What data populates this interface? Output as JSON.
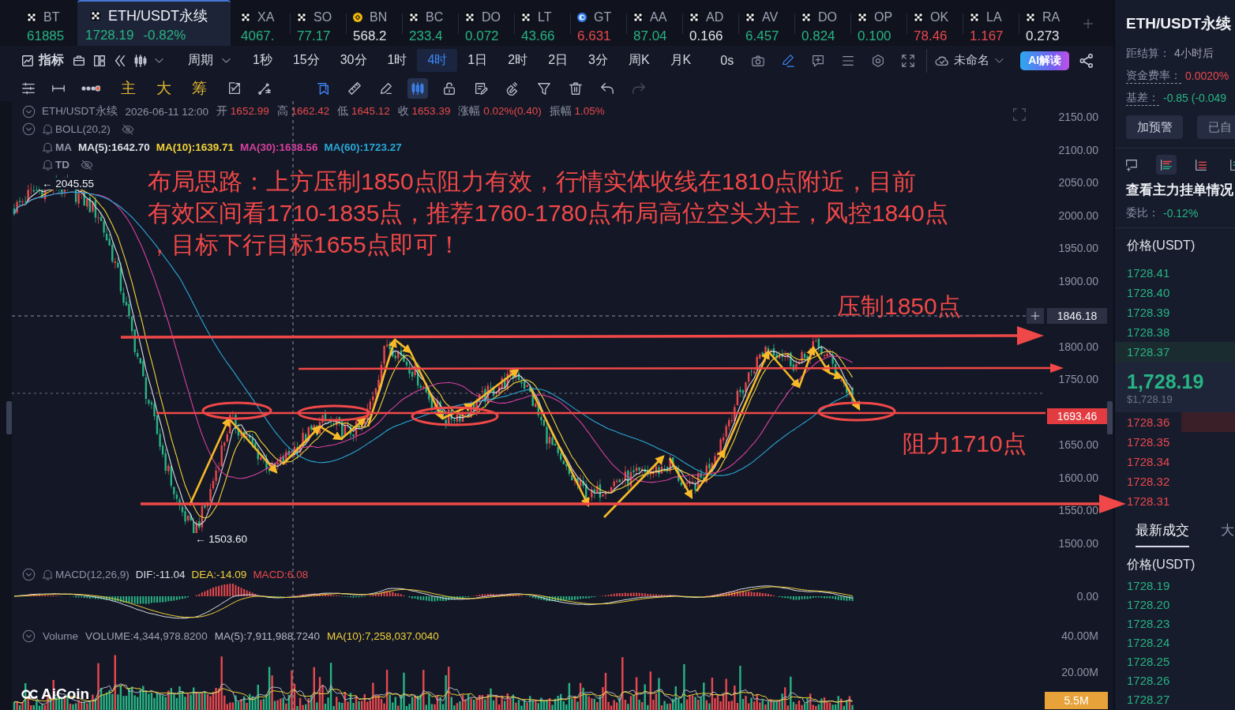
{
  "tabs": [
    {
      "kind": "x",
      "symbol": "BT",
      "price": "61885",
      "color": "#27b383",
      "selected": false
    },
    {
      "kind": "x",
      "symbol": "ETH/USDT永续",
      "price": "1728.19",
      "change": "-0.82%",
      "color": "#27b383",
      "selected": true
    },
    {
      "kind": "x",
      "symbol": "XA",
      "price": "4067.",
      "color": "#27b383",
      "selected": false
    },
    {
      "kind": "x",
      "symbol": "SO",
      "price": "77.17",
      "color": "#27b383",
      "selected": false
    },
    {
      "kind": "coin",
      "symbol": "BN",
      "price": "568.2",
      "color": "#dfe2ea",
      "selected": false
    },
    {
      "kind": "x",
      "symbol": "BC",
      "price": "233.4",
      "color": "#27b383",
      "selected": false
    },
    {
      "kind": "x",
      "symbol": "DO",
      "price": "0.072",
      "color": "#27b383",
      "selected": false
    },
    {
      "kind": "x",
      "symbol": "LT",
      "price": "43.66",
      "color": "#27b383",
      "selected": false
    },
    {
      "kind": "ring",
      "symbol": "GT",
      "price": "6.631",
      "color": "#e8484d",
      "selected": false
    },
    {
      "kind": "x",
      "symbol": "AA",
      "price": "87.04",
      "color": "#27b383",
      "selected": false
    },
    {
      "kind": "x",
      "symbol": "AD",
      "price": "0.166",
      "color": "#dfe2ea",
      "selected": false
    },
    {
      "kind": "x",
      "symbol": "AV",
      "price": "6.457",
      "color": "#27b383",
      "selected": false
    },
    {
      "kind": "x",
      "symbol": "DO",
      "price": "0.824",
      "color": "#27b383",
      "selected": false
    },
    {
      "kind": "x",
      "symbol": "OP",
      "price": "0.100",
      "color": "#27b383",
      "selected": false
    },
    {
      "kind": "x",
      "symbol": "OK",
      "price": "78.46",
      "color": "#e8484d",
      "selected": false
    },
    {
      "kind": "x",
      "symbol": "LA",
      "price": "1.167",
      "color": "#e8484d",
      "selected": false
    },
    {
      "kind": "x",
      "symbol": "RA",
      "price": "0.273",
      "color": "#dfe2ea",
      "selected": false
    }
  ],
  "toolbar": {
    "indicators": "指标",
    "period_menu": "周期",
    "periods": [
      {
        "label": "1秒",
        "selected": false
      },
      {
        "label": "15分",
        "selected": false
      },
      {
        "label": "30分",
        "selected": false
      },
      {
        "label": "1时",
        "selected": false
      },
      {
        "label": "4时",
        "selected": true
      },
      {
        "label": "1日",
        "selected": false
      },
      {
        "label": "2时",
        "selected": false
      },
      {
        "label": "2日",
        "selected": false
      },
      {
        "label": "3分",
        "selected": false
      },
      {
        "label": "周K",
        "selected": false
      },
      {
        "label": "月K",
        "selected": false
      }
    ],
    "countdown": "0s",
    "tools": [
      {
        "kind": "camera",
        "on": false
      },
      {
        "kind": "pen",
        "on": true
      },
      {
        "kind": "comment",
        "on": false
      },
      {
        "kind": "list",
        "on": false
      },
      {
        "kind": "settings",
        "on": false
      },
      {
        "kind": "expand",
        "on": false
      }
    ],
    "layout_name": "未命名",
    "ai_button": "AI解读"
  },
  "drawing_toolbar": {
    "quick_buttons": [
      "主",
      "大",
      "筹"
    ],
    "tools": [
      {
        "kind": "bookmark",
        "on": true,
        "selected": false,
        "disabled": false
      },
      {
        "kind": "ruler",
        "on": false,
        "selected": false,
        "disabled": false
      },
      {
        "kind": "eraser",
        "on": false,
        "selected": false,
        "disabled": false
      },
      {
        "kind": "candles",
        "on": true,
        "selected": true,
        "disabled": false
      },
      {
        "kind": "lock",
        "on": false,
        "selected": false,
        "disabled": false
      },
      {
        "kind": "note",
        "on": false,
        "selected": false,
        "disabled": false
      },
      {
        "kind": "magnet",
        "on": false,
        "selected": false,
        "disabled": false
      },
      {
        "kind": "filter",
        "on": false,
        "selected": false,
        "disabled": false
      },
      {
        "kind": "trash",
        "on": false,
        "selected": false,
        "disabled": false
      },
      {
        "kind": "undo",
        "on": false,
        "selected": false,
        "disabled": false
      },
      {
        "kind": "redo",
        "on": false,
        "selected": false,
        "disabled": true
      }
    ]
  },
  "legend": {
    "symbol": "ETH/USDT永续",
    "time": "2026-06-11 12:00",
    "color": "#e8484d",
    "fields": [
      {
        "label": "开",
        "value": "1652.99"
      },
      {
        "label": "高",
        "value": "1662.42"
      },
      {
        "label": "低",
        "value": "1645.12"
      },
      {
        "label": "收",
        "value": "1653.39"
      },
      {
        "label": "涨幅",
        "value": "0.02%(0.40)"
      },
      {
        "label": "振幅",
        "value": "1.05%"
      }
    ],
    "boll": "BOLL(20,2)",
    "ma_label": "MA",
    "ma": [
      {
        "text": "MA(5):1642.70",
        "color": "#dcdfe6"
      },
      {
        "text": "MA(10):1639.71",
        "color": "#f2d13a"
      },
      {
        "text": "MA(30):1638.56",
        "color": "#d6409f"
      },
      {
        "text": "MA(60):1723.27",
        "color": "#2aa6d6"
      }
    ],
    "td": "TD"
  },
  "analysis_note": [
    "布局思路：上方压制1850点阻力有效，行情实体收线在1810点附近，目前",
    "有效区间看1710-1835点，推荐1760-1780点布局高位空头为主，风控1840点",
    "，目标下行目标1655点即可！"
  ],
  "resistance_label": "压制1850点",
  "support_label": "阻力1710点",
  "chart_markers": {
    "high": "← 2045.55",
    "low": "← 1503.60"
  },
  "price_axis": {
    "ticks": [
      "2150.00",
      "2100.00",
      "2050.00",
      "2000.00",
      "1950.00",
      "1900.00",
      "1800.00",
      "1750.00",
      "1650.00",
      "1600.00",
      "1550.00",
      "1500.00"
    ],
    "crosshair_price": "1846.18",
    "last_price_tag": "1693.46"
  },
  "macd": {
    "label": "MACD(12,26,9)",
    "values": [
      {
        "text": "DIF:-11.04",
        "color": "#dcdfe6"
      },
      {
        "text": "DEA:-14.09",
        "color": "#f2d13a"
      },
      {
        "text": "MACD:6.08",
        "color": "#e8484d"
      }
    ],
    "axis": [
      "0.00"
    ]
  },
  "volume": {
    "label": "Volume",
    "values": [
      {
        "text": "VOLUME:4,344,978.8200",
        "color": "#9aa0b0"
      },
      {
        "text": "MA(5):7,911,988.7240",
        "color": "#b4b8c4"
      },
      {
        "text": "MA(10):7,258,037.0040",
        "color": "#f2d13a"
      }
    ],
    "axis": [
      "40.00M",
      "20.00M"
    ],
    "current_tag": "5.5M"
  },
  "chart_logo": "AiCoin",
  "side_panel": {
    "title": "ETH/USDT永续",
    "stats": [
      {
        "label": "距结算：",
        "value": "4小时后",
        "color": "#9ca1b2",
        "dotted": false
      },
      {
        "label": "资金费率：",
        "value": "0.0020%",
        "color": "#e8484d",
        "dotted": true
      },
      {
        "label": "基差：",
        "value": "-0.85 (-0.049",
        "color": "#27b383",
        "dotted": true
      }
    ],
    "buttons": [
      "加预警",
      "已自"
    ],
    "views": [
      {
        "kind": "comment",
        "selected": false
      },
      {
        "kind": "both",
        "selected": true
      },
      {
        "kind": "bids",
        "selected": false
      },
      {
        "kind": "asks",
        "selected": false
      }
    ],
    "depth_title": "查看主力挂单情况",
    "ratio": {
      "label": "委比：",
      "value": "-0.12%",
      "color": "#27b383"
    },
    "book_header": "价格(USDT)",
    "asks": [
      {
        "price": "1728.41"
      },
      {
        "price": "1728.40"
      },
      {
        "price": "1728.39"
      },
      {
        "price": "1728.38"
      },
      {
        "price": "1728.37",
        "level": 1
      }
    ],
    "last_price": {
      "text": "1,728.19",
      "color": "#27b383"
    },
    "last_price_usd": "$1,728.19",
    "bids": [
      {
        "price": "1728.36",
        "level": 0.45
      },
      {
        "price": "1728.35"
      },
      {
        "price": "1728.34"
      },
      {
        "price": "1728.32"
      },
      {
        "price": "1728.31"
      }
    ],
    "trade_tabs": [
      {
        "label": "最新成交",
        "selected": true
      },
      {
        "label": "大",
        "selected": false
      }
    ],
    "trades_header": "价格(USDT)",
    "trades": [
      {
        "price": "1728.19",
        "color": "#27b383"
      },
      {
        "price": "1728.20",
        "color": "#27b383"
      },
      {
        "price": "1728.23",
        "color": "#27b383"
      },
      {
        "price": "1728.24",
        "color": "#27b383"
      },
      {
        "price": "1728.25",
        "color": "#27b383"
      },
      {
        "price": "1728.26",
        "color": "#27b383"
      },
      {
        "price": "1728.27",
        "color": "#27b383"
      }
    ]
  }
}
